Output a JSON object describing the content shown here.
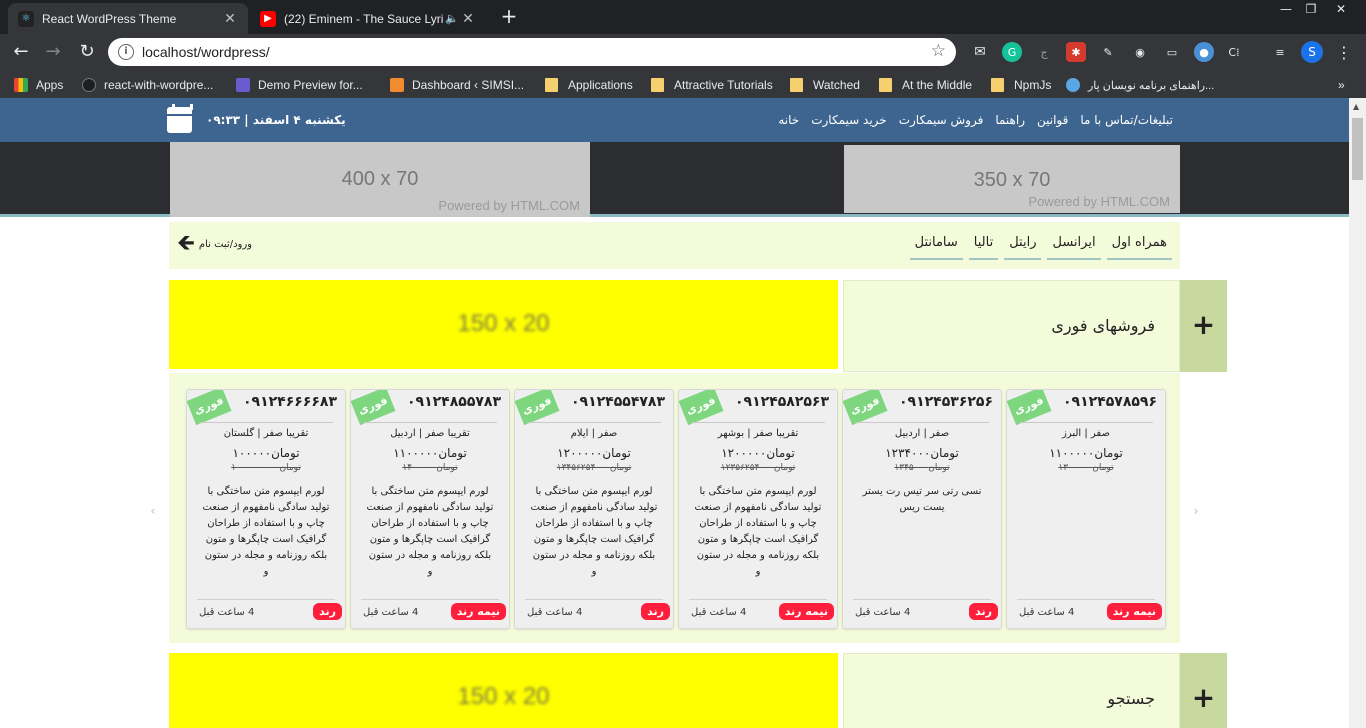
{
  "browser": {
    "tabs": [
      {
        "title": "React WordPress Theme",
        "active": true
      },
      {
        "title": "(22) Eminem - The Sauce Lyri",
        "active": false
      }
    ],
    "url": "localhost/wordpress/",
    "bookmarks": [
      "Apps",
      "react-with-wordpre...",
      "Demo Preview for...",
      "Dashboard ‹ SIMSI...",
      "Applications",
      "Attractive Tutorials",
      "Watched",
      "At the Middle",
      "NpmJs",
      "راهنمای برنامه نویسان پار..."
    ],
    "overflow": "»",
    "profile_initial": "S"
  },
  "site": {
    "nav": [
      "خانه",
      "خرید سیمکارت",
      "فروش سیمکارت",
      "راهنما",
      "قوانین",
      "تبلیغات/تماس با ما"
    ],
    "datetime": "یکشنبه ۴ اسفند | ۰۹:۳۳",
    "ads": {
      "left": {
        "size": "400 x 70",
        "powered": "Powered by HTML.COM"
      },
      "right": {
        "size": "350 x 70",
        "powered": "Powered by HTML.COM"
      },
      "yellow": "150 x 20"
    },
    "operators": [
      "همراه اول",
      "ایرانسل",
      "رایتل",
      "تالیا",
      "سامانتل"
    ],
    "login": "ورود/ثبت نام",
    "sections": {
      "instant_sales": "فروشهای فوری",
      "search": "جستجو"
    },
    "plus": "+",
    "cards": [
      {
        "phone": "۰۹۱۲۴۵۷۸۵۹۶",
        "badge": "فوری",
        "loc": "صفر | البرز",
        "price": "تومان۱۱۰۰۰۰۰",
        "old": "تومان۱۳۰۰۰۰۰",
        "desc": "",
        "status": "نیمه رند",
        "ago": "4 ساعت قبل"
      },
      {
        "phone": "۰۹۱۲۴۵۳۶۲۵۶",
        "badge": "فوری",
        "loc": "صفر | اردبیل",
        "price": "تومان۱۲۳۴۰۰۰",
        "old": "تومان۱۳۴۵۰۰۰",
        "desc": "نسی رتی سر تیس رت یستر یست ریس",
        "status": "رند",
        "ago": "4 ساعت قبل"
      },
      {
        "phone": "۰۹۱۲۴۵۸۲۵۶۳",
        "badge": "فوری",
        "loc": "تقریبا صفر | بوشهر",
        "price": "تومان۱۲۰۰۰۰۰",
        "old": "تومان۱۲۳۵۶۲۵۴۰۰۰",
        "desc": "لورم ایپسوم متن ساختگی با تولید سادگی نامفهوم از صنعت چاپ و با استفاده از طراحان گرافیک است چاپگرها و متون بلکه روزنامه و مجله در ستون و",
        "status": "نیمه رند",
        "ago": "4 ساعت قبل"
      },
      {
        "phone": "۰۹۱۲۴۵۵۴۷۸۳",
        "badge": "فوری",
        "loc": "صفر | ایلام",
        "price": "تومان۱۲۰۰۰۰۰",
        "old": "تومان۱۳۴۵۶۲۵۴۰۰۰",
        "desc": "لورم ایپسوم متن ساختگی با تولید سادگی نامفهوم از صنعت چاپ و با استفاده از طراحان گرافیک است چاپگرها و متون بلکه روزنامه و مجله در ستون و",
        "status": "رند",
        "ago": "4 ساعت قبل"
      },
      {
        "phone": "۰۹۱۲۴۸۵۵۷۸۳",
        "badge": "فوری",
        "loc": "تقریبا صفر | اردبیل",
        "price": "تومان۱۱۰۰۰۰۰",
        "old": "تومان۱۴۰۰۰۰۰",
        "desc": "لورم ایپسوم متن ساختگی با تولید سادگی نامفهوم از صنعت چاپ و با استفاده از طراحان گرافیک است چاپگرها و متون بلکه روزنامه و مجله در ستون و",
        "status": "نیمه رند",
        "ago": "4 ساعت قبل"
      },
      {
        "phone": "۰۹۱۲۴۶۶۶۶۸۳",
        "badge": "فوری",
        "loc": "تقریبا صفر | گلستان",
        "price": "تومان۱۰۰۰۰۰",
        "old": "تومان۱۰۰۰۰۰۰۰۰۰",
        "desc": "لورم ایپسوم متن ساختگی با تولید سادگی نامفهوم از صنعت چاپ و با استفاده از طراحان گرافیک است چاپگرها و متون بلکه روزنامه و مجله در ستون و",
        "status": "رند",
        "ago": "4 ساعت قبل"
      }
    ]
  }
}
